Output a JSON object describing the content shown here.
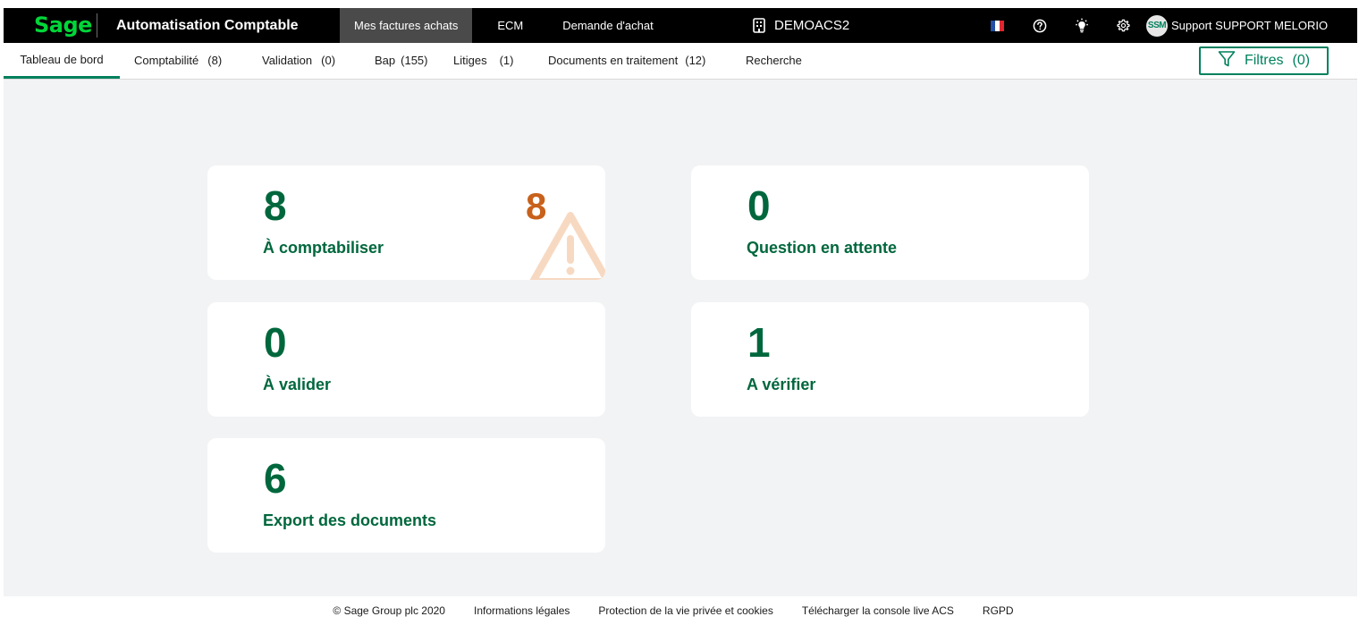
{
  "brand": {
    "logo_text": "Sage",
    "app_title": "Automatisation Comptable"
  },
  "top_nav": {
    "items": [
      {
        "label": "Mes factures achats",
        "active": true
      },
      {
        "label": "ECM",
        "active": false
      },
      {
        "label": "Demande d'achat",
        "active": false
      }
    ]
  },
  "company": {
    "icon": "building-icon",
    "name": "DEMOACS2"
  },
  "top_icons": [
    "france-flag-icon",
    "help-icon",
    "lightbulb-icon",
    "gear-icon"
  ],
  "user": {
    "initials": "SSM",
    "name": "Support SUPPORT MELORIO"
  },
  "tabs": [
    {
      "label": "Tableau de bord",
      "count": "",
      "active": true
    },
    {
      "label": "Comptabilité",
      "count": "(8)",
      "active": false
    },
    {
      "label": "Validation",
      "count": "(0)",
      "active": false
    },
    {
      "label": "Bap",
      "count": "(155)",
      "active": false
    },
    {
      "label": "Litiges",
      "count": "(1)",
      "active": false
    },
    {
      "label": "Documents en traitement",
      "count": "(12)",
      "active": false
    },
    {
      "label": "Recherche",
      "count": "",
      "active": false
    }
  ],
  "filter_button": {
    "label": "Filtres",
    "count": "(0)",
    "icon": "filter-icon"
  },
  "cards": [
    {
      "value": "8",
      "label": "À comptabiliser",
      "alert_value": "8",
      "alert_icon": "warning-icon"
    },
    {
      "value": "0",
      "label": "Question en attente"
    },
    {
      "value": "0",
      "label": "À valider"
    },
    {
      "value": "1",
      "label": "A vérifier"
    },
    {
      "value": "6",
      "label": "Export des documents"
    }
  ],
  "footer": {
    "copyright": "© Sage Group plc 2020",
    "links": [
      "Informations légales",
      "Protection de la vie privée et cookies",
      "Télécharger la console live ACS",
      "RGPD"
    ]
  },
  "colors": {
    "accent": "#00815d",
    "card_text": "#00673d",
    "alert": "#c8611b",
    "logo": "#00d639",
    "topbar": "#000000",
    "background": "#f2f3f4"
  }
}
